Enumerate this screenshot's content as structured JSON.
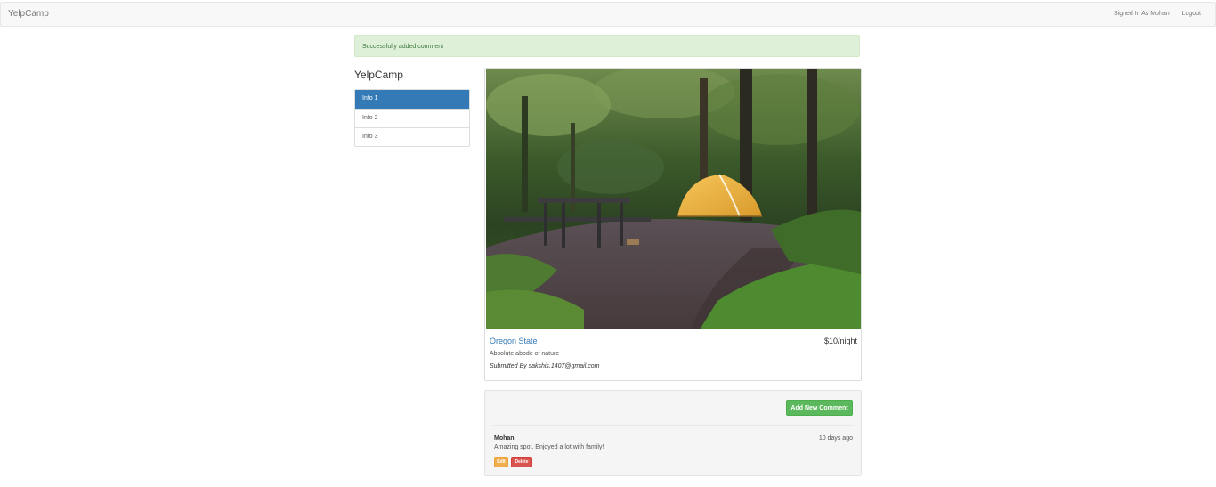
{
  "navbar": {
    "brand": "YelpCamp",
    "signed_in": "Signed In As Mohan",
    "logout": "Logout"
  },
  "flash": {
    "message": "Successfully added comment"
  },
  "sidebar": {
    "title": "YelpCamp",
    "items": [
      {
        "label": "Info 1",
        "active": true
      },
      {
        "label": "Info 2",
        "active": false
      },
      {
        "label": "Info 3",
        "active": false
      }
    ]
  },
  "campground": {
    "name": "Oregon State",
    "price": "$10/night",
    "description": "Absolute abode of nature",
    "submitted_by": "Submitted By sakshis.1407@gmail.com",
    "image_icon": "campsite-photo"
  },
  "comments": {
    "add_button": "Add New Comment",
    "items": [
      {
        "author": "Mohan",
        "time": "10 days ago",
        "text": "Amazing spot. Enjoyed a lot with family!",
        "edit_label": "Edit",
        "delete_label": "Delete"
      }
    ]
  },
  "colors": {
    "primary": "#337ab7",
    "success": "#5cb85c",
    "warning": "#f0ad4e",
    "danger": "#d9534f",
    "flash_bg": "#dff0d8"
  }
}
